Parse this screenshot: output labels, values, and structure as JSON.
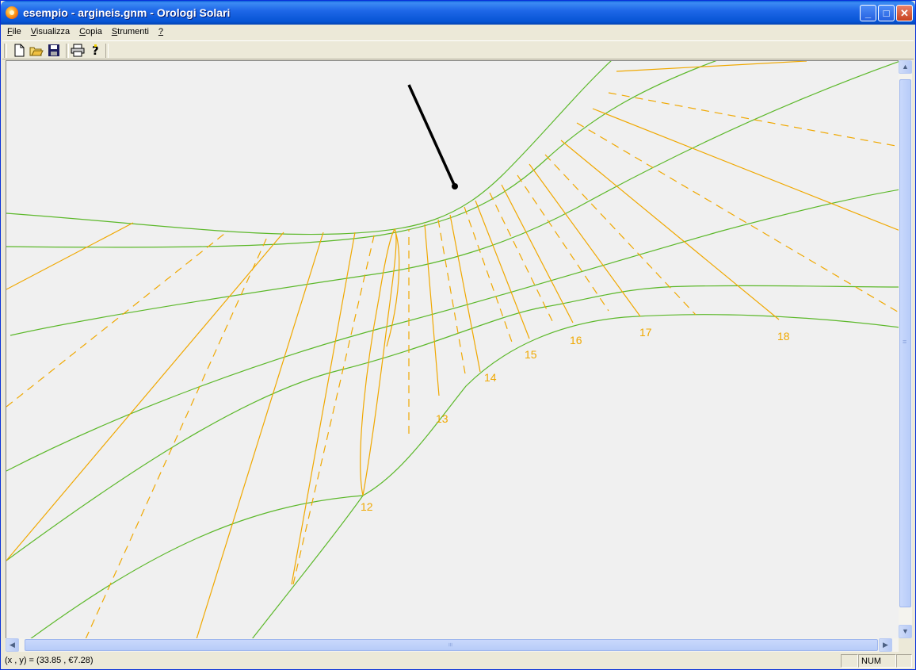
{
  "window": {
    "title": "esempio - argineis.gnm - Orologi Solari"
  },
  "title_buttons": {
    "minimize": "_",
    "maximize": "□",
    "close": "✕"
  },
  "menu": [
    {
      "hotkey": "F",
      "rest": "ile"
    },
    {
      "hotkey": "V",
      "rest": "isualizza"
    },
    {
      "hotkey": "C",
      "rest": "opia"
    },
    {
      "hotkey": "S",
      "rest": "trumenti"
    },
    {
      "hotkey": "?",
      "rest": ""
    }
  ],
  "toolbar_icons": [
    "new-file-icon",
    "open-folder-icon",
    "save-disk-icon",
    "print-icon",
    "help-icon"
  ],
  "dial": {
    "hour_labels": [
      "12",
      "13",
      "14",
      "15",
      "16",
      "17",
      "18"
    ],
    "colors": {
      "hour_lines": "#f0a800",
      "declination_lines": "#5cb82a",
      "gnomon": "#000000",
      "background": "#f0f0f0"
    }
  },
  "scrollbars": {
    "up": "▲",
    "down": "▼",
    "left": "◀",
    "right": "▶",
    "grip": "≡"
  },
  "status": {
    "coords": "(x , y) = (33.85 , €7.28)",
    "num": "NUM"
  }
}
